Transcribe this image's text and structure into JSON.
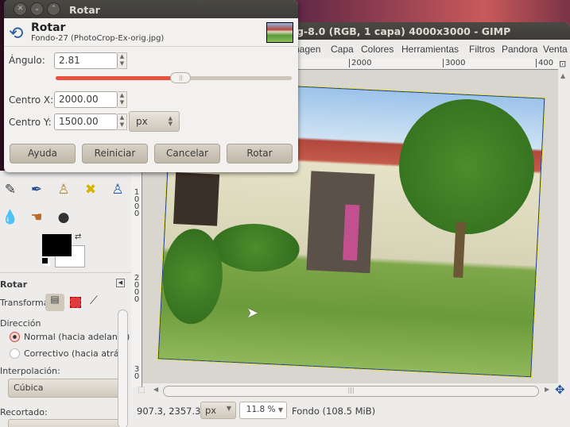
{
  "image_window": {
    "title": "g-8.0 (RGB, 1 capa) 4000x3000 - GIMP",
    "menu": [
      "nagen",
      "Capa",
      "Colores",
      "Herramientas",
      "Filtros",
      "Pandora",
      "Venta"
    ],
    "ruler_top": [
      "2000",
      "3000",
      "400"
    ],
    "ruler_left": [
      "1000",
      "2000",
      "30"
    ],
    "status": {
      "coords": "907.3, 2357.3",
      "unit": "px",
      "zoom": "11.8 %",
      "layer": "Fondo (108.5 MiB)"
    }
  },
  "dialog": {
    "window_title": "Rotar",
    "header_title": "Rotar",
    "header_subtitle": "Fondo-27 (PhotoCrop-Ex-orig.jpg)",
    "angle_label": "Ángulo:",
    "angle_value": "2.81",
    "angle_slider_fraction": 0.53,
    "cx_label": "Centro X:",
    "cx_value": "2000.00",
    "cy_label": "Centro Y:",
    "cy_value": "1500.00",
    "unit": "px",
    "buttons": {
      "help": "Ayuda",
      "reset": "Reiniciar",
      "cancel": "Cancelar",
      "rotate": "Rotar"
    }
  },
  "tool_options": {
    "title": "Rotar",
    "transform_label": "Transformar:",
    "direction_label": "Dirección",
    "direction_options": [
      {
        "label": "Normal (hacia adelante)",
        "selected": true
      },
      {
        "label": "Correctivo (hacia atrás)",
        "selected": false
      }
    ],
    "interpolation_label": "Interpolación:",
    "interpolation_value": "Cúbica",
    "clipping_label": "Recortado:"
  },
  "colors": {
    "accent": "#e9503e",
    "fg": "#000000",
    "bg": "#ffffff"
  }
}
